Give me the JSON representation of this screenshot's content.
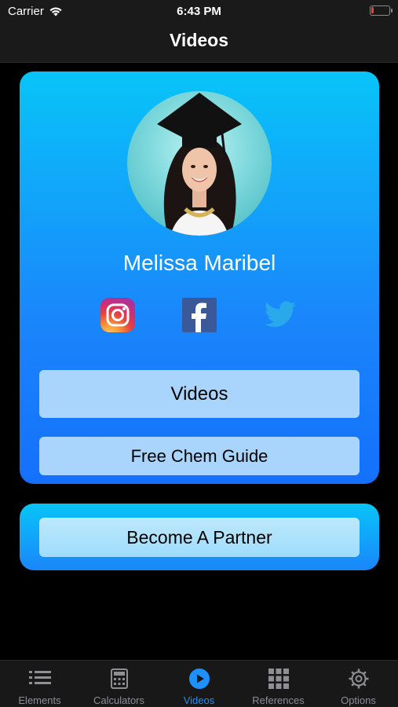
{
  "status_bar": {
    "carrier": "Carrier",
    "time": "6:43 PM",
    "battery_color": "#ff3b30"
  },
  "nav": {
    "title": "Videos"
  },
  "profile": {
    "name": "Melissa Maribel",
    "avatar_description_icon": "graduation-portrait",
    "social": [
      {
        "name": "instagram",
        "icon": "instagram-icon"
      },
      {
        "name": "facebook",
        "icon": "facebook-icon"
      },
      {
        "name": "twitter",
        "icon": "twitter-icon"
      }
    ],
    "buttons": {
      "videos": "Videos",
      "guide": "Free Chem Guide"
    }
  },
  "partner": {
    "button": "Become A Partner"
  },
  "tabs": [
    {
      "label": "Elements",
      "icon": "list-icon",
      "active": false
    },
    {
      "label": "Calculators",
      "icon": "calculator-icon",
      "active": false
    },
    {
      "label": "Videos",
      "icon": "play-icon",
      "active": true
    },
    {
      "label": "References",
      "icon": "grid-icon",
      "active": false
    },
    {
      "label": "Options",
      "icon": "gear-icon",
      "active": false
    }
  ],
  "colors": {
    "accent": "#1e90ff",
    "card_top": "#08c4f8",
    "card_bottom": "#1470fb",
    "button_bg": "#a9d5fd"
  }
}
